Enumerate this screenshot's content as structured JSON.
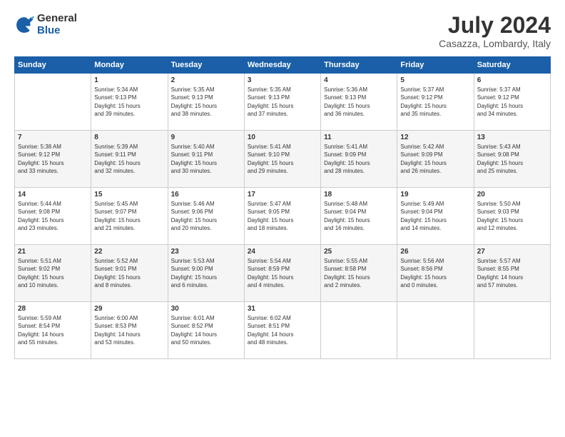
{
  "logo": {
    "general": "General",
    "blue": "Blue"
  },
  "title": "July 2024",
  "location": "Casazza, Lombardy, Italy",
  "headers": [
    "Sunday",
    "Monday",
    "Tuesday",
    "Wednesday",
    "Thursday",
    "Friday",
    "Saturday"
  ],
  "weeks": [
    [
      {
        "day": "",
        "info": ""
      },
      {
        "day": "1",
        "info": "Sunrise: 5:34 AM\nSunset: 9:13 PM\nDaylight: 15 hours\nand 39 minutes."
      },
      {
        "day": "2",
        "info": "Sunrise: 5:35 AM\nSunset: 9:13 PM\nDaylight: 15 hours\nand 38 minutes."
      },
      {
        "day": "3",
        "info": "Sunrise: 5:35 AM\nSunset: 9:13 PM\nDaylight: 15 hours\nand 37 minutes."
      },
      {
        "day": "4",
        "info": "Sunrise: 5:36 AM\nSunset: 9:13 PM\nDaylight: 15 hours\nand 36 minutes."
      },
      {
        "day": "5",
        "info": "Sunrise: 5:37 AM\nSunset: 9:12 PM\nDaylight: 15 hours\nand 35 minutes."
      },
      {
        "day": "6",
        "info": "Sunrise: 5:37 AM\nSunset: 9:12 PM\nDaylight: 15 hours\nand 34 minutes."
      }
    ],
    [
      {
        "day": "7",
        "info": "Sunrise: 5:38 AM\nSunset: 9:12 PM\nDaylight: 15 hours\nand 33 minutes."
      },
      {
        "day": "8",
        "info": "Sunrise: 5:39 AM\nSunset: 9:11 PM\nDaylight: 15 hours\nand 32 minutes."
      },
      {
        "day": "9",
        "info": "Sunrise: 5:40 AM\nSunset: 9:11 PM\nDaylight: 15 hours\nand 30 minutes."
      },
      {
        "day": "10",
        "info": "Sunrise: 5:41 AM\nSunset: 9:10 PM\nDaylight: 15 hours\nand 29 minutes."
      },
      {
        "day": "11",
        "info": "Sunrise: 5:41 AM\nSunset: 9:09 PM\nDaylight: 15 hours\nand 28 minutes."
      },
      {
        "day": "12",
        "info": "Sunrise: 5:42 AM\nSunset: 9:09 PM\nDaylight: 15 hours\nand 26 minutes."
      },
      {
        "day": "13",
        "info": "Sunrise: 5:43 AM\nSunset: 9:08 PM\nDaylight: 15 hours\nand 25 minutes."
      }
    ],
    [
      {
        "day": "14",
        "info": "Sunrise: 5:44 AM\nSunset: 9:08 PM\nDaylight: 15 hours\nand 23 minutes."
      },
      {
        "day": "15",
        "info": "Sunrise: 5:45 AM\nSunset: 9:07 PM\nDaylight: 15 hours\nand 21 minutes."
      },
      {
        "day": "16",
        "info": "Sunrise: 5:46 AM\nSunset: 9:06 PM\nDaylight: 15 hours\nand 20 minutes."
      },
      {
        "day": "17",
        "info": "Sunrise: 5:47 AM\nSunset: 9:05 PM\nDaylight: 15 hours\nand 18 minutes."
      },
      {
        "day": "18",
        "info": "Sunrise: 5:48 AM\nSunset: 9:04 PM\nDaylight: 15 hours\nand 16 minutes."
      },
      {
        "day": "19",
        "info": "Sunrise: 5:49 AM\nSunset: 9:04 PM\nDaylight: 15 hours\nand 14 minutes."
      },
      {
        "day": "20",
        "info": "Sunrise: 5:50 AM\nSunset: 9:03 PM\nDaylight: 15 hours\nand 12 minutes."
      }
    ],
    [
      {
        "day": "21",
        "info": "Sunrise: 5:51 AM\nSunset: 9:02 PM\nDaylight: 15 hours\nand 10 minutes."
      },
      {
        "day": "22",
        "info": "Sunrise: 5:52 AM\nSunset: 9:01 PM\nDaylight: 15 hours\nand 8 minutes."
      },
      {
        "day": "23",
        "info": "Sunrise: 5:53 AM\nSunset: 9:00 PM\nDaylight: 15 hours\nand 6 minutes."
      },
      {
        "day": "24",
        "info": "Sunrise: 5:54 AM\nSunset: 8:59 PM\nDaylight: 15 hours\nand 4 minutes."
      },
      {
        "day": "25",
        "info": "Sunrise: 5:55 AM\nSunset: 8:58 PM\nDaylight: 15 hours\nand 2 minutes."
      },
      {
        "day": "26",
        "info": "Sunrise: 5:56 AM\nSunset: 8:56 PM\nDaylight: 15 hours\nand 0 minutes."
      },
      {
        "day": "27",
        "info": "Sunrise: 5:57 AM\nSunset: 8:55 PM\nDaylight: 14 hours\nand 57 minutes."
      }
    ],
    [
      {
        "day": "28",
        "info": "Sunrise: 5:59 AM\nSunset: 8:54 PM\nDaylight: 14 hours\nand 55 minutes."
      },
      {
        "day": "29",
        "info": "Sunrise: 6:00 AM\nSunset: 8:53 PM\nDaylight: 14 hours\nand 53 minutes."
      },
      {
        "day": "30",
        "info": "Sunrise: 6:01 AM\nSunset: 8:52 PM\nDaylight: 14 hours\nand 50 minutes."
      },
      {
        "day": "31",
        "info": "Sunrise: 6:02 AM\nSunset: 8:51 PM\nDaylight: 14 hours\nand 48 minutes."
      },
      {
        "day": "",
        "info": ""
      },
      {
        "day": "",
        "info": ""
      },
      {
        "day": "",
        "info": ""
      }
    ]
  ]
}
